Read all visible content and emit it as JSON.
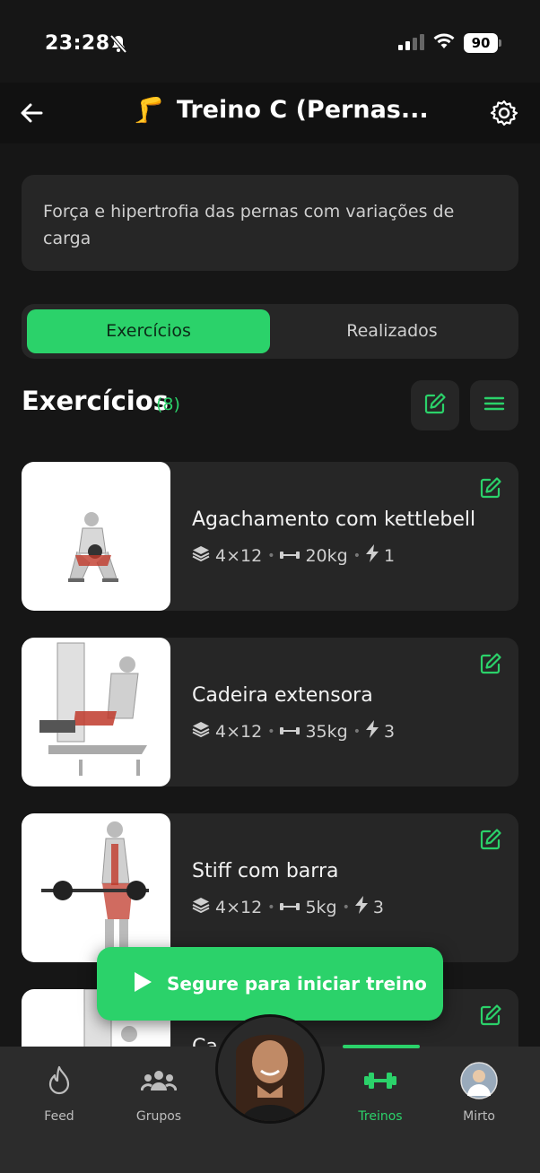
{
  "status_bar": {
    "time": "23:28",
    "battery": "90"
  },
  "header": {
    "title": "Treino C (Pernas...",
    "emoji": "🦵"
  },
  "description": "Força e hipertrofia das pernas com variações de carga",
  "tabs": [
    {
      "label": "Exercícios",
      "active": true
    },
    {
      "label": "Realizados",
      "active": false
    }
  ],
  "section": {
    "title": "Exercícios",
    "count": "(8)"
  },
  "exercises": [
    {
      "name": "Agachamento com kettlebell",
      "sets": "4×12",
      "weight": "20kg",
      "rest": "1"
    },
    {
      "name": "Cadeira extensora",
      "sets": "4×12",
      "weight": "35kg",
      "rest": "3"
    },
    {
      "name": "Stiff com barra",
      "sets": "4×12",
      "weight": "5kg",
      "rest": "3"
    },
    {
      "name": "Ca...",
      "sets": "",
      "weight": "",
      "rest": ""
    }
  ],
  "start_button": {
    "label": "Segure para iniciar treino"
  },
  "nav": [
    {
      "label": "Feed",
      "icon": "flame-icon"
    },
    {
      "label": "Grupos",
      "icon": "group-icon"
    },
    {
      "label": "Treinos",
      "icon": "dumbbell-icon",
      "active": true
    },
    {
      "label": "Mirto",
      "icon": "avatar"
    }
  ],
  "colors": {
    "accent": "#2bd26a",
    "bg": "#161616",
    "card": "#262626"
  }
}
